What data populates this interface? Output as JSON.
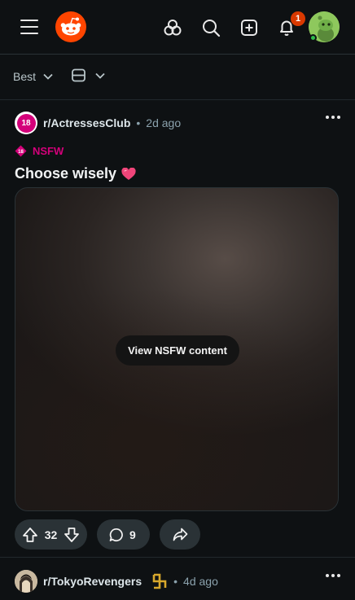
{
  "header": {
    "notification_count": "1",
    "icons": [
      "menu-icon",
      "reddit-logo",
      "popular-icon",
      "search-icon",
      "create-icon",
      "bell-icon",
      "avatar"
    ]
  },
  "sort": {
    "label": "Best",
    "view_icon": "card-view-icon"
  },
  "posts": [
    {
      "subreddit": "r/ActressesClub",
      "subreddit_icon_text": "18",
      "age": "2d ago",
      "tag": "NSFW",
      "title": "Choose wisely",
      "title_emoji": "heart",
      "media_button": "View NSFW content",
      "votes": "32",
      "comments": "9"
    },
    {
      "subreddit": "r/TokyoRevengers",
      "age": "4d ago"
    }
  ],
  "colors": {
    "background": "#0e1113",
    "nsfw": "#d4007a",
    "badge": "#d93900",
    "pill": "#2a3236"
  }
}
